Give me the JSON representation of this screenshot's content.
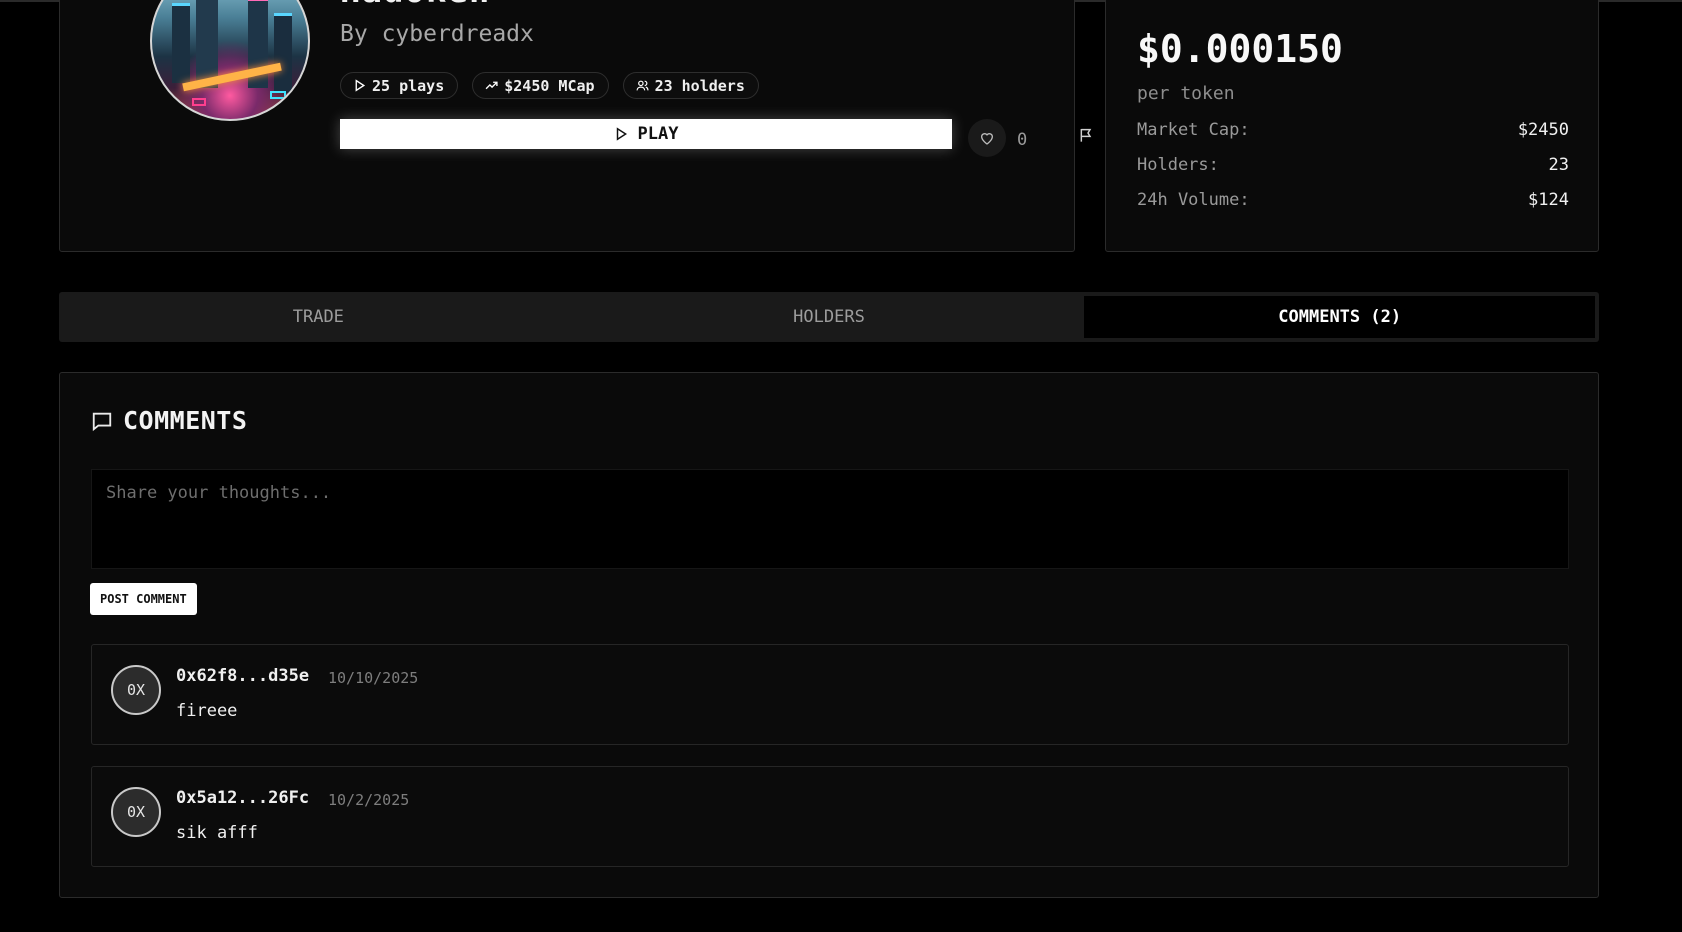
{
  "game": {
    "title": "Hadoken",
    "by_prefix": "By",
    "author": "cyberdreadx",
    "stats": {
      "plays": "25 plays",
      "mcap": "$2450 MCap",
      "holders": "23 holders"
    },
    "play_label": "PLAY",
    "likes": "0",
    "icons": {
      "plays": "play-icon",
      "mcap": "trending-up-icon",
      "holders": "users-icon",
      "like": "heart-icon",
      "report": "flag-icon"
    }
  },
  "price": {
    "value": "$0.000150",
    "unit": "per token",
    "rows": [
      {
        "label": "Market Cap:",
        "value": "$2450"
      },
      {
        "label": "Holders:",
        "value": "23"
      },
      {
        "label": "24h Volume:",
        "value": "$124"
      }
    ]
  },
  "tabs": [
    {
      "label": "TRADE",
      "active": false
    },
    {
      "label": "HOLDERS",
      "active": false
    },
    {
      "label": "COMMENTS (2)",
      "active": true
    }
  ],
  "comments": {
    "title": "COMMENTS",
    "input_placeholder": "Share your thoughts...",
    "post_label": "POST COMMENT",
    "items": [
      {
        "avatar": "0X",
        "author": "0x62f8...d35e",
        "date": "10/10/2025",
        "text": "fireee"
      },
      {
        "avatar": "0X",
        "author": "0x5a12...26Fc",
        "date": "10/2/2025",
        "text": "sik afff"
      }
    ]
  },
  "colors": {
    "background": "#000000",
    "card": "#0a0a0a",
    "border": "#2b2b2b",
    "accent": "#ffffff"
  }
}
